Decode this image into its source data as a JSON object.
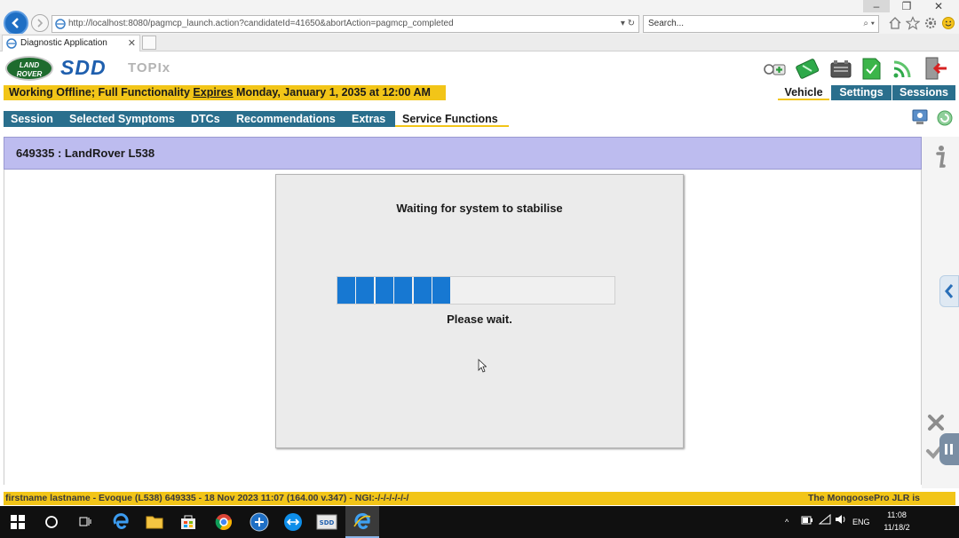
{
  "browser": {
    "url": "http://localhost:8080/pagmcp_launch.action?candidateId=41650&abortAction=pagmcp_completed",
    "search_placeholder": "Search...",
    "tab_title": "Diagnostic Application"
  },
  "app": {
    "lr_logo_text": "LAND ROVER",
    "sdd_logo": "SDD",
    "topix_logo": "TOPIx",
    "offline_prefix": "Working Offline; Full Functionality ",
    "offline_expires": "Expires",
    "offline_suffix": " Monday, January 1, 2035 at 12:00 AM",
    "top_nav": [
      "Vehicle",
      "Settings",
      "Sessions"
    ],
    "menu": [
      "Session",
      "Selected Symptoms",
      "DTCs",
      "Recommendations",
      "Extras",
      "Service Functions"
    ],
    "vehicle_header": "649335 : LandRover L538"
  },
  "dialog": {
    "title": "Waiting for system to stabilise",
    "message": "Please wait.",
    "progress_fraction": 0.41
  },
  "status": {
    "left": "firstname lastname - Evoque (L538) 649335 - 18 Nov 2023 11:07 (164.00 v.347) - NGI:-/-/-/-/-/-/",
    "right": "The MongoosePro JLR is"
  },
  "taskbar": {
    "lang": "ENG",
    "time": "11:08",
    "date": "11/18/2"
  },
  "colors": {
    "status_yellow": "#f2c518",
    "menu_teal": "#2a6f8d",
    "vehicle_lavender": "#bdbcef",
    "progress_blue": "#1778d2"
  }
}
